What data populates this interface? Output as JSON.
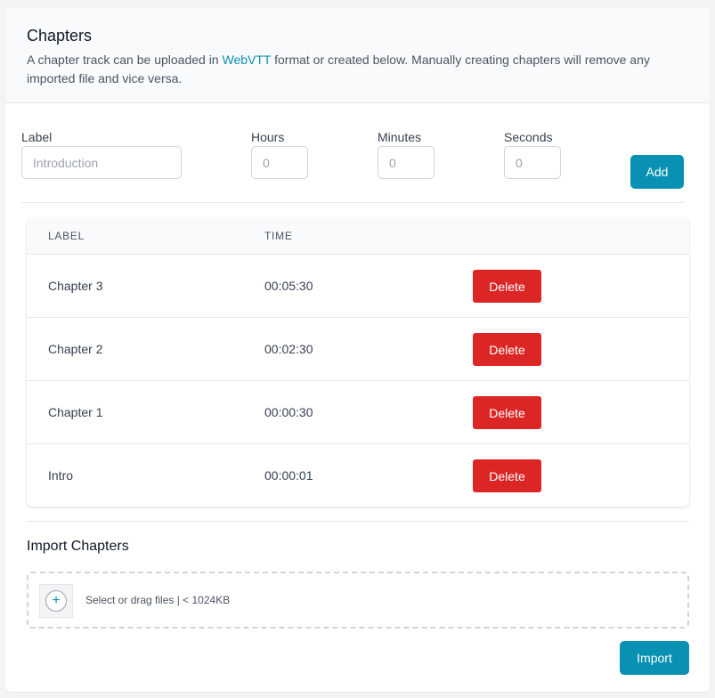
{
  "header": {
    "title": "Chapters",
    "description_before": "A chapter track can be uploaded in ",
    "description_link": "WebVTT",
    "description_after": " format or created below. Manually creating chapters will remove any imported file and vice versa."
  },
  "form": {
    "label_label": "Label",
    "label_placeholder": "Introduction",
    "hours_label": "Hours",
    "hours_placeholder": "0",
    "minutes_label": "Minutes",
    "minutes_placeholder": "0",
    "seconds_label": "Seconds",
    "seconds_placeholder": "0",
    "add_button": "Add"
  },
  "table": {
    "columns": [
      "Label",
      "Time"
    ],
    "rows": [
      {
        "label": "Chapter 3",
        "time": "00:05:30",
        "action": "Delete"
      },
      {
        "label": "Chapter 2",
        "time": "00:02:30",
        "action": "Delete"
      },
      {
        "label": "Chapter 1",
        "time": "00:00:30",
        "action": "Delete"
      },
      {
        "label": "Intro",
        "time": "00:00:01",
        "action": "Delete"
      }
    ]
  },
  "import": {
    "title": "Import Chapters",
    "dropzone_icon": "plus-icon",
    "dropzone_text": "Select or drag files | < 1024KB",
    "import_button": "Import"
  },
  "colors": {
    "accent": "#0891b2",
    "danger": "#dc2626"
  }
}
